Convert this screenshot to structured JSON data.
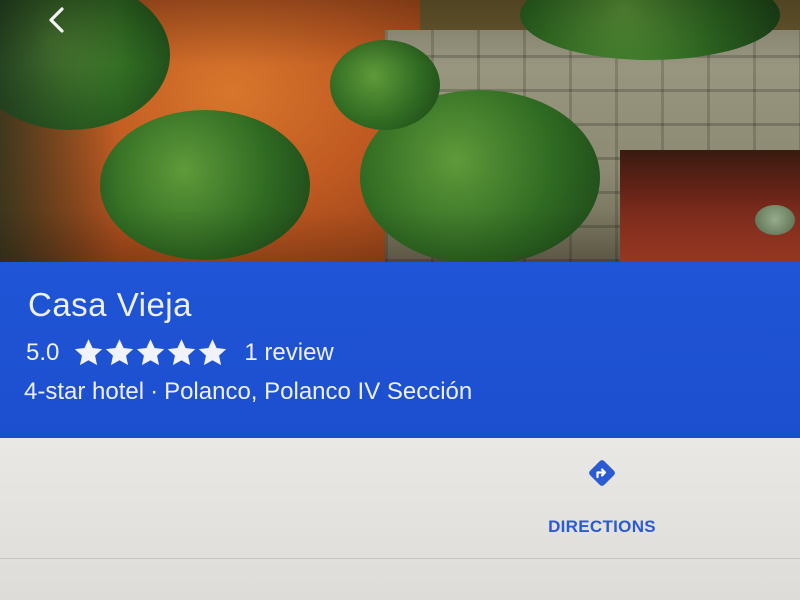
{
  "place": {
    "name": "Casa Vieja",
    "rating": "5.0",
    "stars_filled": 5,
    "stars_total": 5,
    "review_count": "1 review",
    "category": "4-star hotel",
    "separator": "·",
    "location": "Polanco, Polanco IV Sección"
  },
  "actions": {
    "directions_label": "DIRECTIONS"
  },
  "icons": {
    "back": "chevron-left-icon",
    "star": "star-icon",
    "directions": "directions-icon"
  },
  "colors": {
    "panel_blue": "#1f55d6",
    "accent_blue": "#2a5bd3",
    "text_light": "#eef0f8"
  }
}
